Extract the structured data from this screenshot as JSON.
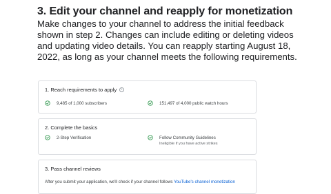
{
  "section": {
    "heading": "3. Edit your channel and reapply for monetization",
    "body": "Make changes to your channel to address the initial feedback shown in step 2. Changes can include editing or deleting videos and updating video details. You can reapply starting August 18, 2022, as long as your channel meets the following requirements."
  },
  "cards": [
    {
      "title": "1. Reach requirements to apply",
      "items": [
        {
          "text": "9,485 of 1,000 subscribers"
        },
        {
          "text": "151,497 of 4,000 public watch hours"
        }
      ]
    },
    {
      "title": "2. Complete the basics",
      "items": [
        {
          "text": "2-Step Verification"
        },
        {
          "text": "Follow Community Guidelines",
          "sub": "Ineligible if you have active strikes"
        }
      ]
    },
    {
      "title": "3. Pass channel reviews",
      "text": "After you submit your application, we'll check if your channel follows ",
      "link": "YouTube's channel monetization"
    }
  ],
  "colors": {
    "check_green": "#1e8e3e",
    "link_blue": "#065fd4",
    "border": "#dadce0"
  },
  "icons": {
    "info": "info-icon",
    "check": "check-circle-icon"
  }
}
